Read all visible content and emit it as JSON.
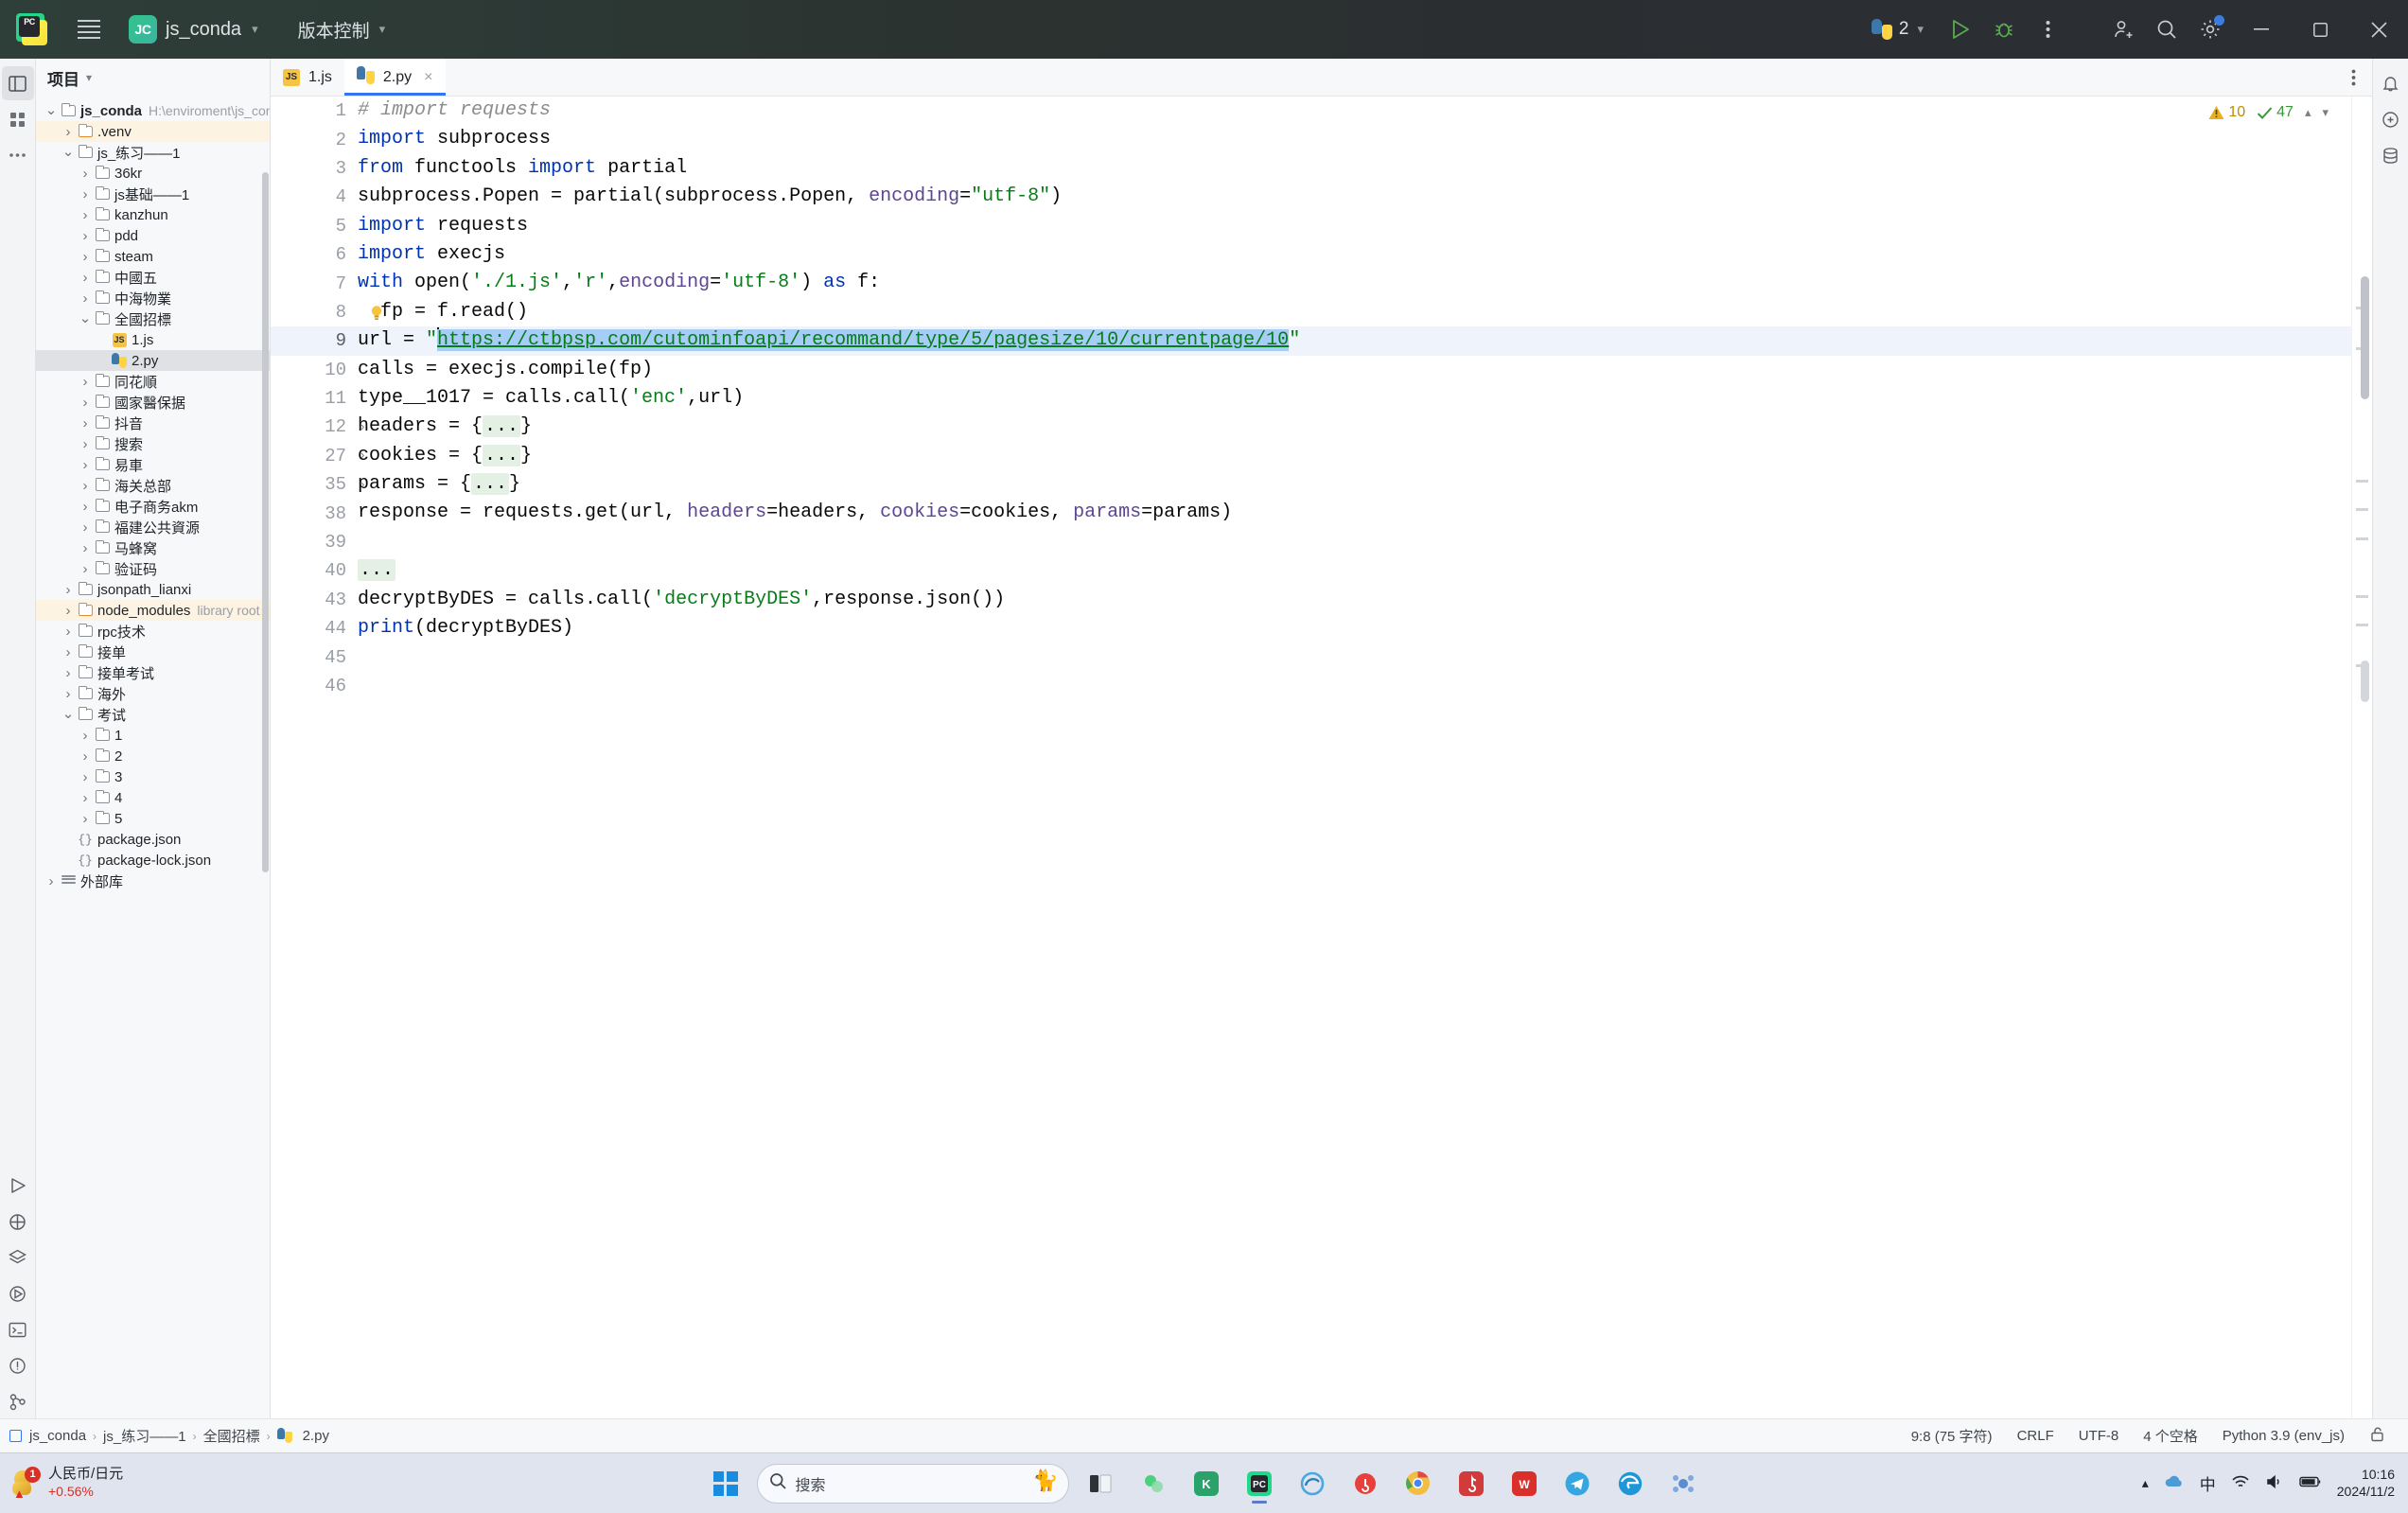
{
  "titlebar": {
    "app_icon": "pycharm-logo",
    "menu_icon": "hamburger-menu-icon",
    "project_badge": "JC",
    "project_name": "js_conda",
    "vcs_label": "版本控制",
    "run_config": "2",
    "icons": {
      "python": "python-icon",
      "run": "run-icon",
      "debug": "debug-icon",
      "more": "more-vertical-icon",
      "account": "add-user-icon",
      "search": "search-icon",
      "settings": "gear-icon",
      "minimize": "minimize-icon",
      "maximize": "maximize-icon",
      "close": "close-icon"
    }
  },
  "rail": {
    "top": [
      "project-icon",
      "structure-icon",
      "more-tools-icon"
    ],
    "bottom": [
      "run-tool-icon",
      "python-console-icon",
      "services-icon",
      "coverage-icon",
      "terminal-icon",
      "problems-icon",
      "vcs-icon"
    ],
    "right": [
      "notifications-icon",
      "ai-assistant-icon",
      "database-icon"
    ]
  },
  "project_panel": {
    "title": "项目",
    "chevron": "chevron-down-icon",
    "tree": [
      {
        "depth": 0,
        "arrow": "down",
        "icon": "folder",
        "label": "js_conda",
        "bold": true,
        "muted": "H:\\enviroment\\js_conda"
      },
      {
        "depth": 1,
        "arrow": "right",
        "icon": "folder-orange",
        "label": ".venv",
        "highlight": "lib"
      },
      {
        "depth": 1,
        "arrow": "down",
        "icon": "folder",
        "label": "js_练习——1"
      },
      {
        "depth": 2,
        "arrow": "right",
        "icon": "folder",
        "label": "36kr"
      },
      {
        "depth": 2,
        "arrow": "right",
        "icon": "folder",
        "label": "js基础——1"
      },
      {
        "depth": 2,
        "arrow": "right",
        "icon": "folder",
        "label": "kanzhun"
      },
      {
        "depth": 2,
        "arrow": "right",
        "icon": "folder",
        "label": "pdd"
      },
      {
        "depth": 2,
        "arrow": "right",
        "icon": "folder",
        "label": "steam"
      },
      {
        "depth": 2,
        "arrow": "right",
        "icon": "folder",
        "label": "中國五"
      },
      {
        "depth": 2,
        "arrow": "right",
        "icon": "folder",
        "label": "中海物業"
      },
      {
        "depth": 2,
        "arrow": "down",
        "icon": "folder",
        "label": "全國招標"
      },
      {
        "depth": 3,
        "arrow": "none",
        "icon": "js",
        "label": "1.js"
      },
      {
        "depth": 3,
        "arrow": "none",
        "icon": "py",
        "label": "2.py",
        "highlight": "sel"
      },
      {
        "depth": 2,
        "arrow": "right",
        "icon": "folder",
        "label": "同花順"
      },
      {
        "depth": 2,
        "arrow": "right",
        "icon": "folder",
        "label": "國家醫保据"
      },
      {
        "depth": 2,
        "arrow": "right",
        "icon": "folder",
        "label": "抖音"
      },
      {
        "depth": 2,
        "arrow": "right",
        "icon": "folder",
        "label": "搜索"
      },
      {
        "depth": 2,
        "arrow": "right",
        "icon": "folder",
        "label": "易車"
      },
      {
        "depth": 2,
        "arrow": "right",
        "icon": "folder",
        "label": "海关总部"
      },
      {
        "depth": 2,
        "arrow": "right",
        "icon": "folder",
        "label": "电子商务akm"
      },
      {
        "depth": 2,
        "arrow": "right",
        "icon": "folder",
        "label": "福建公共資源"
      },
      {
        "depth": 2,
        "arrow": "right",
        "icon": "folder",
        "label": "马蜂窝"
      },
      {
        "depth": 2,
        "arrow": "right",
        "icon": "folder",
        "label": "验证码"
      },
      {
        "depth": 1,
        "arrow": "right",
        "icon": "folder",
        "label": "jsonpath_lianxi"
      },
      {
        "depth": 1,
        "arrow": "right",
        "icon": "folder-orange",
        "label": "node_modules",
        "muted": "library root",
        "highlight": "lib"
      },
      {
        "depth": 1,
        "arrow": "right",
        "icon": "folder",
        "label": "rpc技术"
      },
      {
        "depth": 1,
        "arrow": "right",
        "icon": "folder",
        "label": "接单"
      },
      {
        "depth": 1,
        "arrow": "right",
        "icon": "folder",
        "label": "接单考试"
      },
      {
        "depth": 1,
        "arrow": "right",
        "icon": "folder",
        "label": "海外"
      },
      {
        "depth": 1,
        "arrow": "down",
        "icon": "folder",
        "label": "考试"
      },
      {
        "depth": 2,
        "arrow": "right",
        "icon": "folder",
        "label": "1"
      },
      {
        "depth": 2,
        "arrow": "right",
        "icon": "folder",
        "label": "2"
      },
      {
        "depth": 2,
        "arrow": "right",
        "icon": "folder",
        "label": "3"
      },
      {
        "depth": 2,
        "arrow": "right",
        "icon": "folder",
        "label": "4"
      },
      {
        "depth": 2,
        "arrow": "right",
        "icon": "folder",
        "label": "5"
      },
      {
        "depth": 1,
        "arrow": "none",
        "icon": "json",
        "label": "package.json"
      },
      {
        "depth": 1,
        "arrow": "none",
        "icon": "json",
        "label": "package-lock.json"
      },
      {
        "depth": 0,
        "arrow": "right",
        "icon": "lib",
        "label": "外部库"
      }
    ]
  },
  "editor": {
    "tabs": [
      {
        "label": "1.js",
        "icon": "js-file-icon",
        "active": false,
        "closable": false
      },
      {
        "label": "2.py",
        "icon": "python-file-icon",
        "active": true,
        "closable": true
      }
    ],
    "kebab": "more-options-icon",
    "inspection": {
      "warning_icon": "warning-icon",
      "warning_count": "10",
      "ok_icon": "check-icon",
      "ok_count": "47",
      "up_arrow": "chevron-up-icon",
      "down_arrow": "chevron-down-icon"
    },
    "lines": [
      {
        "num": "1",
        "tokens": [
          {
            "t": "# import requests",
            "c": "com"
          }
        ]
      },
      {
        "num": "2",
        "tokens": [
          {
            "t": "import",
            "c": "kw"
          },
          {
            "t": " subprocess",
            "c": ""
          }
        ]
      },
      {
        "num": "3",
        "tokens": [
          {
            "t": "from",
            "c": "kw"
          },
          {
            "t": " functools ",
            "c": ""
          },
          {
            "t": "import",
            "c": "kw"
          },
          {
            "t": " partial",
            "c": ""
          }
        ]
      },
      {
        "num": "4",
        "tokens": [
          {
            "t": "subprocess.Popen = partial(subprocess.Popen, ",
            "c": ""
          },
          {
            "t": "encoding",
            "c": "kwarg"
          },
          {
            "t": "=",
            "c": ""
          },
          {
            "t": "\"utf-8\"",
            "c": "str"
          },
          {
            "t": ")",
            "c": ""
          }
        ]
      },
      {
        "num": "5",
        "tokens": [
          {
            "t": "import",
            "c": "kw"
          },
          {
            "t": " requests",
            "c": ""
          }
        ]
      },
      {
        "num": "6",
        "tokens": [
          {
            "t": "import",
            "c": "kw"
          },
          {
            "t": " execjs",
            "c": ""
          }
        ]
      },
      {
        "num": "7",
        "tokens": [
          {
            "t": "with",
            "c": "kw"
          },
          {
            "t": " open(",
            "c": ""
          },
          {
            "t": "'./1.js'",
            "c": "str"
          },
          {
            "t": ",",
            "c": ""
          },
          {
            "t": "'r'",
            "c": "str"
          },
          {
            "t": ",",
            "c": ""
          },
          {
            "t": "encoding",
            "c": "kwarg"
          },
          {
            "t": "=",
            "c": ""
          },
          {
            "t": "'utf-8'",
            "c": "str"
          },
          {
            "t": ") ",
            "c": ""
          },
          {
            "t": "as",
            "c": "kw"
          },
          {
            "t": " f:",
            "c": ""
          }
        ]
      },
      {
        "num": "8",
        "bulb": true,
        "tokens": [
          {
            "t": "  fp = f.read()",
            "c": ""
          }
        ]
      },
      {
        "num": "9",
        "current": true,
        "tokens": [
          {
            "t": "url = ",
            "c": ""
          },
          {
            "t": "\"",
            "c": "str"
          },
          {
            "t": "https://ctbpsp.com/cutominfoapi/recommand/type/5/pagesize/10/currentpage/10",
            "c": "url-sel"
          },
          {
            "t": "\"",
            "c": "str"
          }
        ]
      },
      {
        "num": "10",
        "tokens": [
          {
            "t": "calls = execjs.compile(fp)",
            "c": ""
          }
        ]
      },
      {
        "num": "11",
        "tokens": [
          {
            "t": "type__1017 = calls.call(",
            "c": ""
          },
          {
            "t": "'enc'",
            "c": "str"
          },
          {
            "t": ",url)",
            "c": ""
          }
        ]
      },
      {
        "num": "12",
        "fold": true,
        "tokens": [
          {
            "t": "headers = {",
            "c": ""
          },
          {
            "t": "...",
            "c": "fold"
          },
          {
            "t": "}",
            "c": ""
          }
        ]
      },
      {
        "num": "27",
        "fold": true,
        "tokens": [
          {
            "t": "cookies = {",
            "c": ""
          },
          {
            "t": "...",
            "c": "fold"
          },
          {
            "t": "}",
            "c": ""
          }
        ]
      },
      {
        "num": "35",
        "fold": true,
        "tokens": [
          {
            "t": "params = {",
            "c": ""
          },
          {
            "t": "...",
            "c": "fold"
          },
          {
            "t": "}",
            "c": ""
          }
        ]
      },
      {
        "num": "38",
        "tokens": [
          {
            "t": "response = requests.get(url, ",
            "c": ""
          },
          {
            "t": "headers",
            "c": "kwarg"
          },
          {
            "t": "=headers, ",
            "c": ""
          },
          {
            "t": "cookies",
            "c": "kwarg"
          },
          {
            "t": "=cookies, ",
            "c": ""
          },
          {
            "t": "params",
            "c": "kwarg"
          },
          {
            "t": "=params)",
            "c": ""
          }
        ]
      },
      {
        "num": "39",
        "tokens": [
          {
            "t": "",
            "c": ""
          }
        ]
      },
      {
        "num": "40",
        "fold": true,
        "tokens": [
          {
            "t": "...",
            "c": "fold"
          }
        ]
      },
      {
        "num": "43",
        "tokens": [
          {
            "t": "decryptByDES = calls.call(",
            "c": ""
          },
          {
            "t": "'decryptByDES'",
            "c": "str"
          },
          {
            "t": ",response.json())",
            "c": ""
          }
        ]
      },
      {
        "num": "44",
        "tokens": [
          {
            "t": "print",
            "c": "kw"
          },
          {
            "t": "(decryptByDES)",
            "c": ""
          }
        ]
      },
      {
        "num": "45",
        "tokens": [
          {
            "t": "",
            "c": ""
          }
        ]
      },
      {
        "num": "46",
        "tokens": [
          {
            "t": "",
            "c": ""
          }
        ]
      }
    ]
  },
  "statusbar": {
    "breadcrumb": [
      "js_conda",
      "js_练习——1",
      "全國招標",
      "2.py"
    ],
    "file_icon": "python-file-icon",
    "caret": "9:8 (75 字符)",
    "line_ending": "CRLF",
    "encoding": "UTF-8",
    "indent": "4 个空格",
    "interpreter": "Python 3.9 (env_js)",
    "lock_icon": "lock-open-icon"
  },
  "taskbar": {
    "stock": {
      "name": "人民币/日元",
      "change": "+0.56%",
      "badge": "1"
    },
    "start_icon": "windows-start-icon",
    "search_placeholder": "搜索",
    "search_icon": "search-icon",
    "pinned": [
      "task-view-icon",
      "widgets-icon",
      "kuwo-icon",
      "pycharm-icon",
      "edge-dev-icon",
      "chrome-icon",
      "netease-icon",
      "wps-icon",
      "telegram-icon",
      "edge-icon",
      "node-icon"
    ],
    "tray": [
      "chevron-up-icon",
      "cloud-sync-icon",
      "ime-chinese-icon",
      "wifi-icon",
      "volume-icon",
      "battery-icon"
    ],
    "clock_time": "10:16",
    "clock_date": "2024/11/2"
  }
}
